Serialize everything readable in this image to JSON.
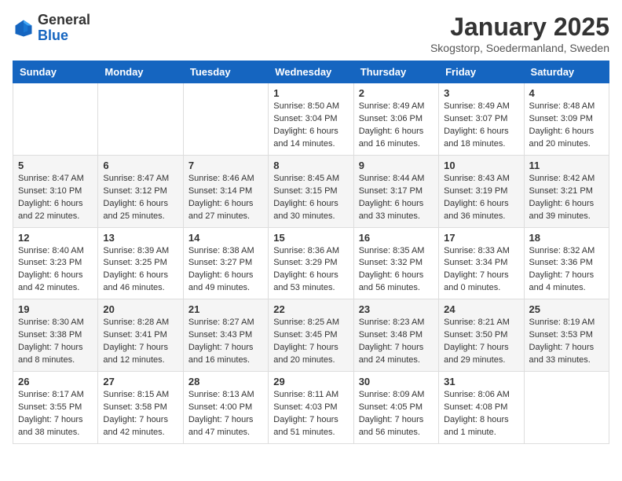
{
  "header": {
    "logo_general": "General",
    "logo_blue": "Blue",
    "month_title": "January 2025",
    "location": "Skogstorp, Soedermanland, Sweden"
  },
  "weekdays": [
    "Sunday",
    "Monday",
    "Tuesday",
    "Wednesday",
    "Thursday",
    "Friday",
    "Saturday"
  ],
  "weeks": [
    [
      {
        "day": "",
        "info": ""
      },
      {
        "day": "",
        "info": ""
      },
      {
        "day": "",
        "info": ""
      },
      {
        "day": "1",
        "info": "Sunrise: 8:50 AM\nSunset: 3:04 PM\nDaylight: 6 hours\nand 14 minutes."
      },
      {
        "day": "2",
        "info": "Sunrise: 8:49 AM\nSunset: 3:06 PM\nDaylight: 6 hours\nand 16 minutes."
      },
      {
        "day": "3",
        "info": "Sunrise: 8:49 AM\nSunset: 3:07 PM\nDaylight: 6 hours\nand 18 minutes."
      },
      {
        "day": "4",
        "info": "Sunrise: 8:48 AM\nSunset: 3:09 PM\nDaylight: 6 hours\nand 20 minutes."
      }
    ],
    [
      {
        "day": "5",
        "info": "Sunrise: 8:47 AM\nSunset: 3:10 PM\nDaylight: 6 hours\nand 22 minutes."
      },
      {
        "day": "6",
        "info": "Sunrise: 8:47 AM\nSunset: 3:12 PM\nDaylight: 6 hours\nand 25 minutes."
      },
      {
        "day": "7",
        "info": "Sunrise: 8:46 AM\nSunset: 3:14 PM\nDaylight: 6 hours\nand 27 minutes."
      },
      {
        "day": "8",
        "info": "Sunrise: 8:45 AM\nSunset: 3:15 PM\nDaylight: 6 hours\nand 30 minutes."
      },
      {
        "day": "9",
        "info": "Sunrise: 8:44 AM\nSunset: 3:17 PM\nDaylight: 6 hours\nand 33 minutes."
      },
      {
        "day": "10",
        "info": "Sunrise: 8:43 AM\nSunset: 3:19 PM\nDaylight: 6 hours\nand 36 minutes."
      },
      {
        "day": "11",
        "info": "Sunrise: 8:42 AM\nSunset: 3:21 PM\nDaylight: 6 hours\nand 39 minutes."
      }
    ],
    [
      {
        "day": "12",
        "info": "Sunrise: 8:40 AM\nSunset: 3:23 PM\nDaylight: 6 hours\nand 42 minutes."
      },
      {
        "day": "13",
        "info": "Sunrise: 8:39 AM\nSunset: 3:25 PM\nDaylight: 6 hours\nand 46 minutes."
      },
      {
        "day": "14",
        "info": "Sunrise: 8:38 AM\nSunset: 3:27 PM\nDaylight: 6 hours\nand 49 minutes."
      },
      {
        "day": "15",
        "info": "Sunrise: 8:36 AM\nSunset: 3:29 PM\nDaylight: 6 hours\nand 53 minutes."
      },
      {
        "day": "16",
        "info": "Sunrise: 8:35 AM\nSunset: 3:32 PM\nDaylight: 6 hours\nand 56 minutes."
      },
      {
        "day": "17",
        "info": "Sunrise: 8:33 AM\nSunset: 3:34 PM\nDaylight: 7 hours\nand 0 minutes."
      },
      {
        "day": "18",
        "info": "Sunrise: 8:32 AM\nSunset: 3:36 PM\nDaylight: 7 hours\nand 4 minutes."
      }
    ],
    [
      {
        "day": "19",
        "info": "Sunrise: 8:30 AM\nSunset: 3:38 PM\nDaylight: 7 hours\nand 8 minutes."
      },
      {
        "day": "20",
        "info": "Sunrise: 8:28 AM\nSunset: 3:41 PM\nDaylight: 7 hours\nand 12 minutes."
      },
      {
        "day": "21",
        "info": "Sunrise: 8:27 AM\nSunset: 3:43 PM\nDaylight: 7 hours\nand 16 minutes."
      },
      {
        "day": "22",
        "info": "Sunrise: 8:25 AM\nSunset: 3:45 PM\nDaylight: 7 hours\nand 20 minutes."
      },
      {
        "day": "23",
        "info": "Sunrise: 8:23 AM\nSunset: 3:48 PM\nDaylight: 7 hours\nand 24 minutes."
      },
      {
        "day": "24",
        "info": "Sunrise: 8:21 AM\nSunset: 3:50 PM\nDaylight: 7 hours\nand 29 minutes."
      },
      {
        "day": "25",
        "info": "Sunrise: 8:19 AM\nSunset: 3:53 PM\nDaylight: 7 hours\nand 33 minutes."
      }
    ],
    [
      {
        "day": "26",
        "info": "Sunrise: 8:17 AM\nSunset: 3:55 PM\nDaylight: 7 hours\nand 38 minutes."
      },
      {
        "day": "27",
        "info": "Sunrise: 8:15 AM\nSunset: 3:58 PM\nDaylight: 7 hours\nand 42 minutes."
      },
      {
        "day": "28",
        "info": "Sunrise: 8:13 AM\nSunset: 4:00 PM\nDaylight: 7 hours\nand 47 minutes."
      },
      {
        "day": "29",
        "info": "Sunrise: 8:11 AM\nSunset: 4:03 PM\nDaylight: 7 hours\nand 51 minutes."
      },
      {
        "day": "30",
        "info": "Sunrise: 8:09 AM\nSunset: 4:05 PM\nDaylight: 7 hours\nand 56 minutes."
      },
      {
        "day": "31",
        "info": "Sunrise: 8:06 AM\nSunset: 4:08 PM\nDaylight: 8 hours\nand 1 minute."
      },
      {
        "day": "",
        "info": ""
      }
    ]
  ]
}
